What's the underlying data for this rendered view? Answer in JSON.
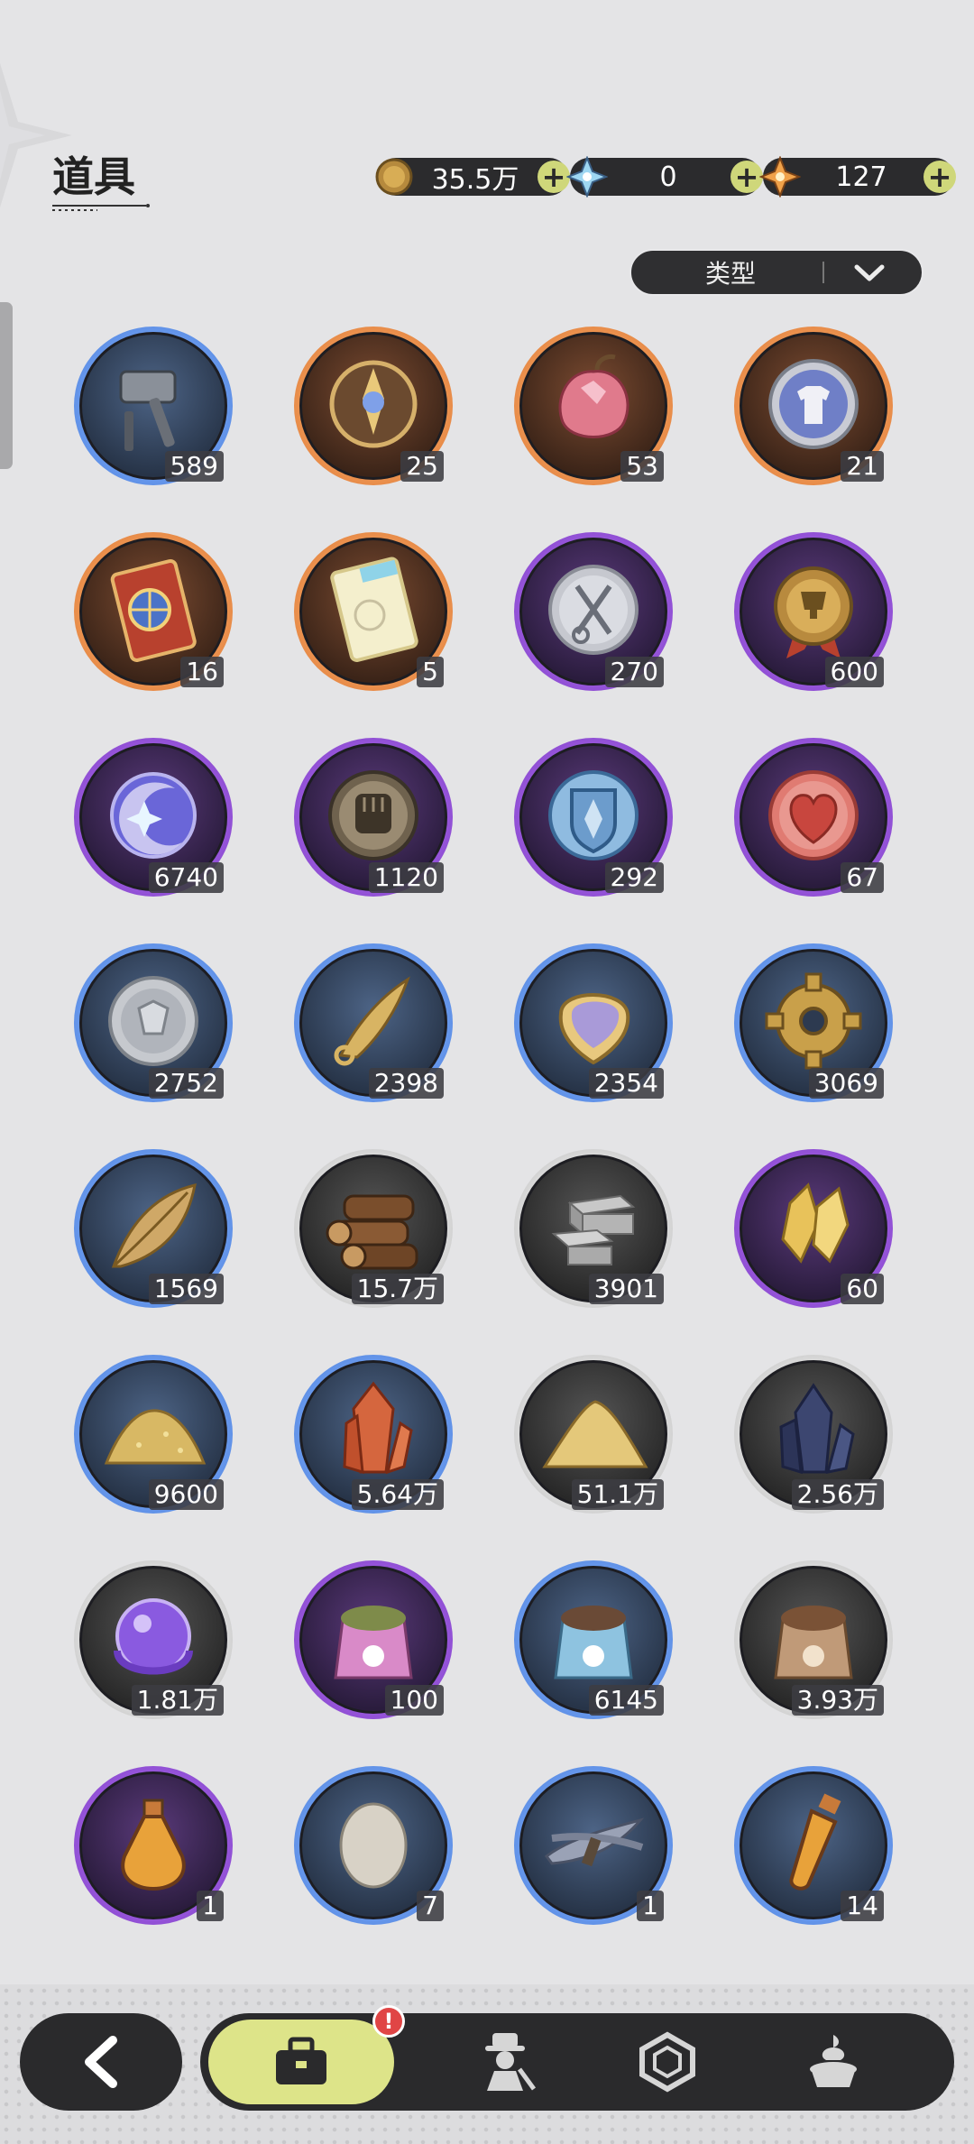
{
  "header": {
    "title": "道具",
    "currencies": [
      {
        "icon": "gold-coin-icon",
        "value": "35.5万"
      },
      {
        "icon": "crystal-star-icon",
        "value": "0"
      },
      {
        "icon": "orange-star-icon",
        "value": "127"
      }
    ],
    "plus_symbol": "+"
  },
  "filter": {
    "label": "类型"
  },
  "items": [
    {
      "icon": "hammer-icon",
      "rarity": "blue",
      "count": "589"
    },
    {
      "icon": "emblem-badge-icon",
      "rarity": "orange",
      "count": "25"
    },
    {
      "icon": "crystal-fruit-icon",
      "rarity": "orange",
      "count": "53"
    },
    {
      "icon": "outfit-coin-icon",
      "rarity": "orange",
      "count": "21"
    },
    {
      "icon": "wheel-ticket-icon",
      "rarity": "orange",
      "count": "16"
    },
    {
      "icon": "rainbow-ticket-icon",
      "rarity": "orange",
      "count": "5"
    },
    {
      "icon": "scissors-coin-icon",
      "rarity": "purple",
      "count": "270"
    },
    {
      "icon": "trophy-medal-icon",
      "rarity": "purple",
      "count": "600"
    },
    {
      "icon": "moon-star-coin-icon",
      "rarity": "purple",
      "count": "6740"
    },
    {
      "icon": "fist-coin-icon",
      "rarity": "purple",
      "count": "1120"
    },
    {
      "icon": "shield-coin-icon",
      "rarity": "purple",
      "count": "292"
    },
    {
      "icon": "heart-coin-icon",
      "rarity": "purple",
      "count": "67"
    },
    {
      "icon": "silver-coin-icon",
      "rarity": "blue",
      "count": "2752"
    },
    {
      "icon": "fang-icon",
      "rarity": "blue",
      "count": "2398"
    },
    {
      "icon": "scale-icon",
      "rarity": "blue",
      "count": "2354"
    },
    {
      "icon": "gear-icon",
      "rarity": "blue",
      "count": "3069"
    },
    {
      "icon": "leaf-icon",
      "rarity": "blue",
      "count": "1569"
    },
    {
      "icon": "logs-icon",
      "rarity": "gray",
      "count": "15.7万"
    },
    {
      "icon": "stone-bricks-icon",
      "rarity": "gray",
      "count": "3901"
    },
    {
      "icon": "gold-crystal-icon",
      "rarity": "purple",
      "count": "60"
    },
    {
      "icon": "gold-dust-pile-icon",
      "rarity": "blue",
      "count": "9600"
    },
    {
      "icon": "red-crystal-icon",
      "rarity": "blue",
      "count": "5.64万"
    },
    {
      "icon": "sand-pile-icon",
      "rarity": "gray",
      "count": "51.1万"
    },
    {
      "icon": "dark-crystal-icon",
      "rarity": "gray",
      "count": "2.56万"
    },
    {
      "icon": "purple-orb-icon",
      "rarity": "gray",
      "count": "1.81万"
    },
    {
      "icon": "pink-food-bag-icon",
      "rarity": "purple",
      "count": "100"
    },
    {
      "icon": "blue-food-bag-icon",
      "rarity": "blue",
      "count": "6145"
    },
    {
      "icon": "brown-food-bag-icon",
      "rarity": "gray",
      "count": "3.93万"
    },
    {
      "icon": "potion-bottle-icon",
      "rarity": "purple",
      "count": "1"
    },
    {
      "icon": "egg-icon",
      "rarity": "blue",
      "count": "7"
    },
    {
      "icon": "feather-bundle-icon",
      "rarity": "blue",
      "count": "1"
    },
    {
      "icon": "vial-icon",
      "rarity": "blue",
      "count": "14"
    }
  ],
  "nav": {
    "back": "back-arrow-icon",
    "badge": "!",
    "tabs": [
      "bag-icon",
      "character-icon",
      "gem-icon",
      "dessert-icon"
    ]
  },
  "colors": {
    "blue": "#5a8ce6",
    "orange": "#e8853f",
    "purple": "#8a4fd2",
    "gray": "#c9c9c9",
    "accent": "#dde489"
  }
}
